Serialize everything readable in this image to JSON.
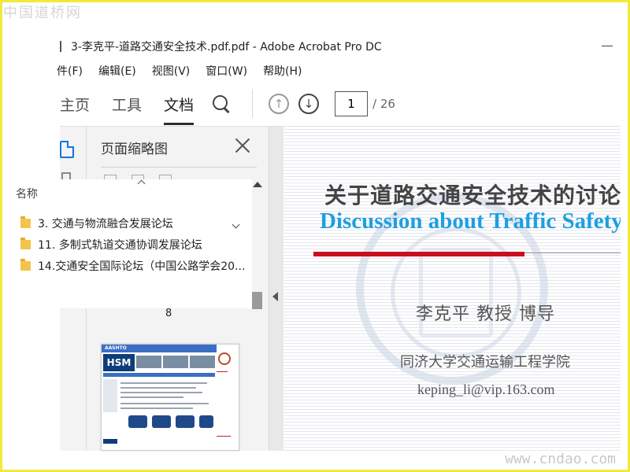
{
  "watermark": {
    "top": "中国道桥网",
    "bottom": "www.cndao.com"
  },
  "window": {
    "title": "3-李克平-道路交通安全技术.pdf.pdf - Adobe Acrobat Pro DC"
  },
  "menu": [
    "件(F)",
    "编辑(E)",
    "视图(V)",
    "窗口(W)",
    "帮助(H)"
  ],
  "toolbar": {
    "tabs": [
      "主页",
      "工具",
      "文档"
    ],
    "active_tab": "文档",
    "page_current": "1",
    "page_total": "/ 26"
  },
  "thumbnail_panel": {
    "title": "页面缩略图",
    "page_label": "8",
    "thumb_header": "AASHTO",
    "thumb_logo": "HSM"
  },
  "bookmark_popup": {
    "header": "名称",
    "items": [
      "3. 交通与物流融合发展论坛",
      "11. 多制式轨道交通协调发展论坛",
      "14.交通安全国际论坛（中国公路学会20..."
    ]
  },
  "document": {
    "title_cn": "关于道路交通安全技术的讨论",
    "title_en": "Discussion about Traffic Safety",
    "author": "李克平  教授 博导",
    "affiliation": "同济大学交通运输工程学院",
    "email": "keping_li@vip.163.com"
  },
  "colors": {
    "accent_blue": "#1473e6",
    "title_blue": "#1e9fe0",
    "rule_red": "#c8101e",
    "frame_yellow": "#f1ea3a"
  }
}
